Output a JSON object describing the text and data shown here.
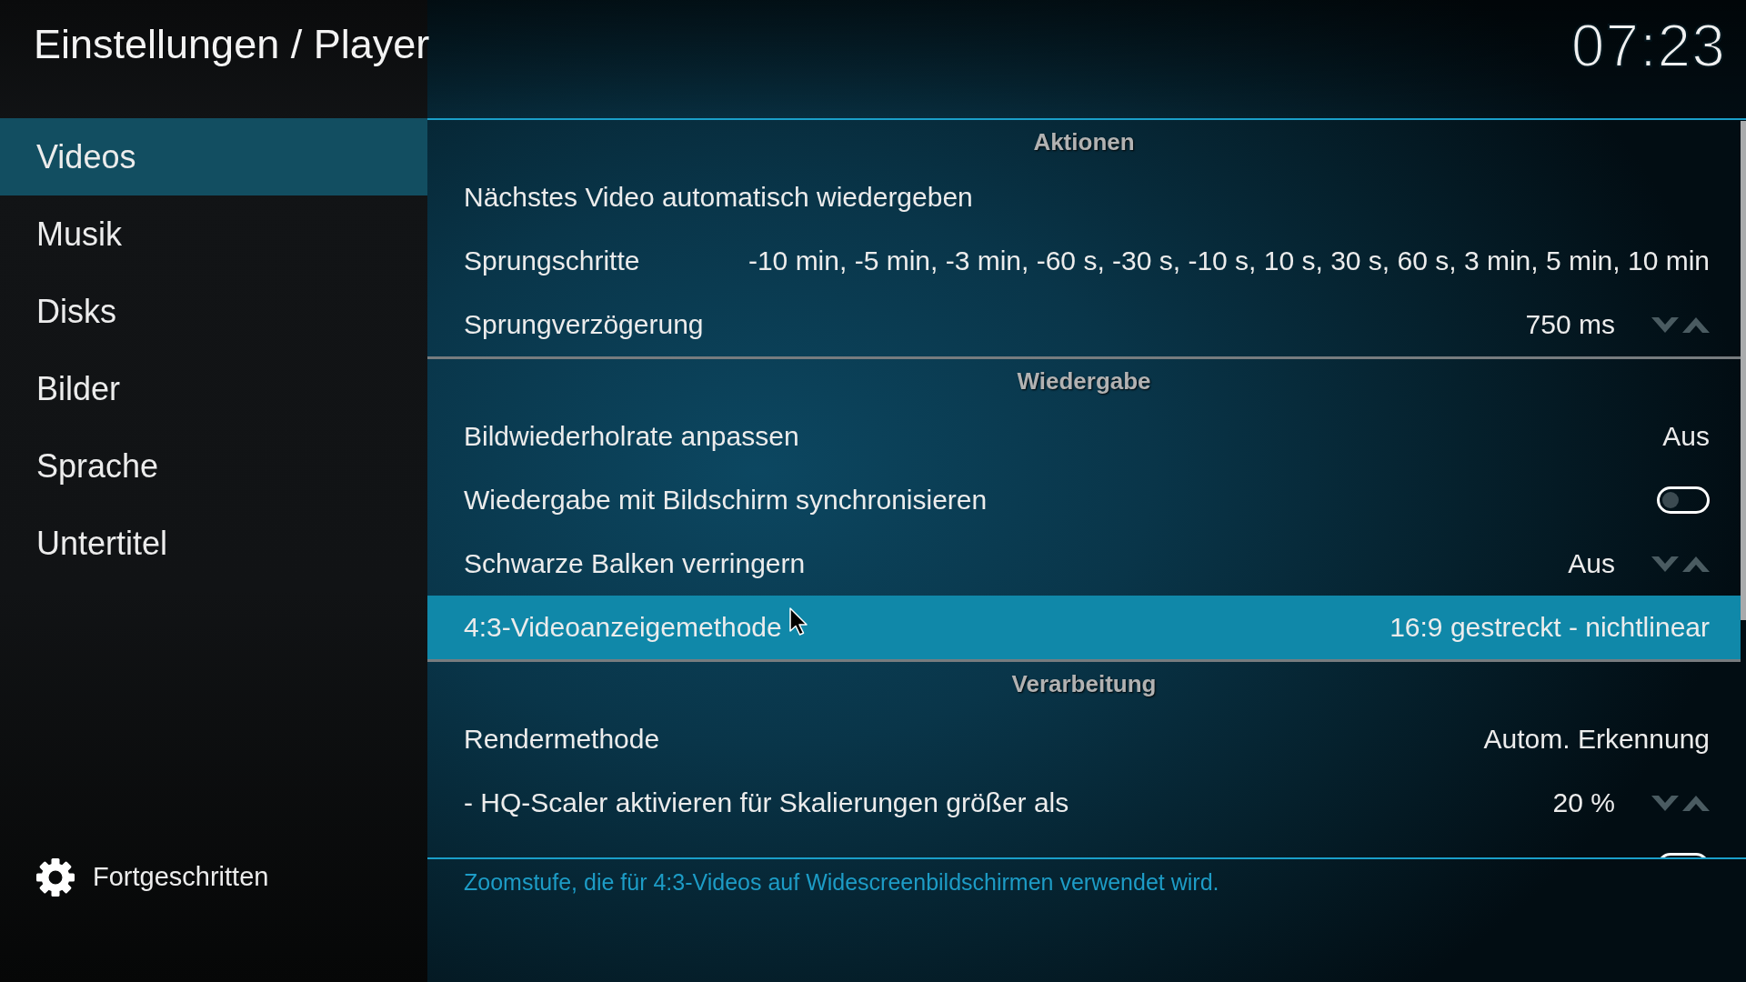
{
  "header": {
    "title": "Einstellungen / Player",
    "clock": "07:23"
  },
  "sidebar": {
    "items": [
      {
        "label": "Videos",
        "selected": true
      },
      {
        "label": "Musik",
        "selected": false
      },
      {
        "label": "Disks",
        "selected": false
      },
      {
        "label": "Bilder",
        "selected": false
      },
      {
        "label": "Sprache",
        "selected": false
      },
      {
        "label": "Untertitel",
        "selected": false
      }
    ],
    "footer": {
      "label": "Fortgeschritten"
    }
  },
  "sections": [
    {
      "title": "Aktionen",
      "rows": [
        {
          "kind": "action",
          "label": "Nächstes Video automatisch wiedergeben",
          "selected": false
        },
        {
          "kind": "list",
          "label": "Sprungschritte",
          "value": "-10 min, -5 min, -3 min, -60 s, -30 s, -10 s, 10 s, 30 s, 60 s, 3 min, 5 min, 10 min",
          "selected": false
        },
        {
          "kind": "spinner",
          "label": "Sprungverzögerung",
          "value": "750 ms",
          "selected": false
        }
      ]
    },
    {
      "title": "Wiedergabe",
      "rows": [
        {
          "kind": "list",
          "label": "Bildwiederholrate anpassen",
          "value": "Aus",
          "selected": false
        },
        {
          "kind": "toggle",
          "label": "Wiedergabe mit Bildschirm synchronisieren",
          "on": false,
          "selected": false
        },
        {
          "kind": "spinner",
          "label": "Schwarze Balken verringern",
          "value": "Aus",
          "selected": false
        },
        {
          "kind": "list",
          "label": "4:3-Videoanzeigemethode",
          "value": "16:9 gestreckt - nichtlinear",
          "selected": true
        }
      ]
    },
    {
      "title": "Verarbeitung",
      "rows": [
        {
          "kind": "list",
          "label": "Rendermethode",
          "value": "Autom. Erkennung",
          "selected": false
        },
        {
          "kind": "spinner",
          "label": "- HQ-Scaler aktivieren für Skalierungen größer als",
          "value": "20 %",
          "selected": false
        },
        {
          "kind": "toggle",
          "selected": false
        }
      ]
    }
  ],
  "description": "Zoomstufe, die für 4:3-Videos auf Widescreenbildschirmen verwendet wird."
}
